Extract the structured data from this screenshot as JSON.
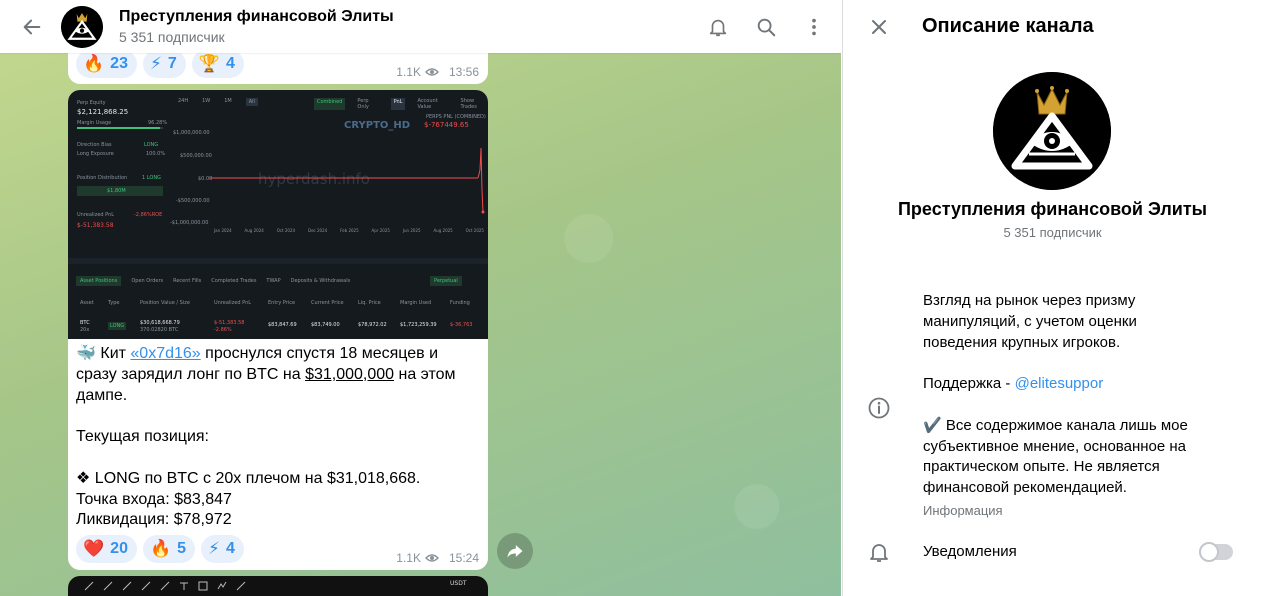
{
  "chat_header": {
    "title": "Преступления финансовой Элиты",
    "subscribers": "5 351 подписчик"
  },
  "messages": [
    {
      "reactions": [
        {
          "emoji": "🔥",
          "count": "23"
        },
        {
          "emoji": "⚡",
          "count": "7"
        },
        {
          "emoji": "🏆",
          "count": "4"
        }
      ],
      "views": "1.1K",
      "time": "13:56"
    },
    {
      "screenshot": {
        "watermark1": "CRYPTO_HD",
        "watermark2": "hyperdash.info",
        "equity_label": "Perp Equity",
        "equity_value": "$2,121,868.25",
        "margin_usage_label": "Margin Usage",
        "margin_usage_value": "96.28%",
        "direction_label": "Direction Bias",
        "direction_value": "LONG",
        "long_exposure_label": "Long Exposure",
        "long_exposure_value": "100.0%",
        "position_dist_label": "Position Distribution",
        "position_dist_value": "1 LONG",
        "position_dist_bar": "$1,80M",
        "upnl_label": "Unrealized PnL",
        "upnl_pct": "-2,86%ROE",
        "upnl_value": "$-51,383.58",
        "pnl_label": "PERPS PNL (COMBINED)",
        "pnl_value": "$-767449.65",
        "range_tabs": [
          "24H",
          "1W",
          "1M",
          "All"
        ],
        "chart_tabs": [
          "Combined",
          "Perp Only",
          "PnL",
          "Account Value",
          "Show Trades"
        ],
        "y_ticks": [
          "$1,000,000.00",
          "$500,000.00",
          "$0.00",
          "-$500,000.00",
          "-$1,000,000.00"
        ],
        "x_ticks": [
          "Jan 2024",
          "Aug 2024",
          "Oct 2024",
          "Dec 2024",
          "Feb 2025",
          "Apr 2025",
          "Jun 2025",
          "Aug 2025",
          "Oct 2025"
        ],
        "table_tabs": [
          "Asset Positions",
          "Open Orders",
          "Recent Fills",
          "Completed Trades",
          "TWAP",
          "Deposits & Withdrawals"
        ],
        "table_right_tab": "Perpetual",
        "columns": [
          "Asset",
          "Type",
          "Position Value / Size",
          "Unrealized PnL",
          "Entry Price",
          "Current Price",
          "Liq. Price",
          "Margin Used",
          "Funding"
        ],
        "row": {
          "asset": "BTC",
          "asset_sub": "20x",
          "type": "LONG",
          "value": "$30,618,668.79",
          "size": "370.02820 BTC",
          "upnl": "$-51,383.58",
          "upnl_pct": "-2.86%",
          "entry": "$83,847.69",
          "current": "$83,749.00",
          "liq": "$78,972.02",
          "margin": "$1,723,259.39",
          "funding": "$-36,763"
        }
      },
      "text_lines": [
        {
          "parts": [
            "🐳 Кит ",
            "«0x7d16»",
            " проснулся спустя 18 месяцев и"
          ]
        },
        {
          "parts": [
            "сразу зарядил лонг по BTC на ",
            "$31,000,000",
            " на этом"
          ]
        },
        {
          "parts": [
            "дампе."
          ]
        }
      ],
      "text_block2": [
        "Текущая позиция:"
      ],
      "text_block3": [
        "❖ LONG по BTC с 20x плечом на $31,018,668.",
        "Точка входа: $83,847",
        "Ликвидация: $78,972"
      ],
      "reactions": [
        {
          "emoji": "❤️",
          "count": "20"
        },
        {
          "emoji": "🔥",
          "count": "5"
        },
        {
          "emoji": "⚡",
          "count": "4"
        }
      ],
      "views": "1.1K",
      "time": "15:24"
    }
  ],
  "third_preview": {
    "ticker": "USDT"
  },
  "panel": {
    "title": "Описание канала",
    "channel_name": "Преступления финансовой Элиты",
    "subscribers": "5 351 подписчик",
    "desc1": "Взгляд на рынок через призму",
    "desc2": "манипуляций, с учетом оценки",
    "desc3": "поведения крупных игроков.",
    "support_prefix": "Поддержка - ",
    "support_link": "@elitesuppor",
    "disc1": "✔️ Все содержимое канала лишь мое",
    "disc2": "субъективное мнение, основанное на",
    "disc3": "практическом опыте. Не является",
    "disc4": "финансовой рекомендацией.",
    "info_label": "Информация",
    "notifications_label": "Уведомления",
    "notifications_on": false
  }
}
